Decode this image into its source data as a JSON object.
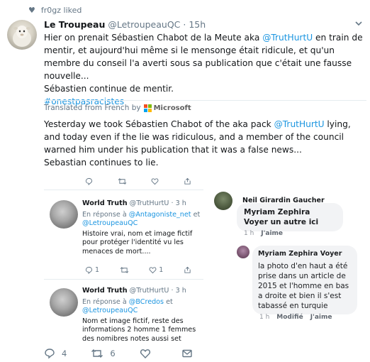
{
  "social_context": {
    "text": "fr0gz liked"
  },
  "tweet": {
    "author_name": "Le Troupeau",
    "author_handle": "@LetroupeauQC",
    "separator": "·",
    "time": "15h",
    "text_part1": "Hier on prenait Sébastien Chabot de la Meute aka ",
    "mention": "@TrutHurtU",
    "text_part2": " en train de mentir, et aujourd'hui même si le mensonge était ridicule, et qu'un membre du conseil l'a averti sous sa publication que c'était une fausse nouvelle...",
    "text_line3": "Sébastien continue de mentir.",
    "hashtag": "#onestpasracistes",
    "translated_label": "Translated from French by",
    "translator_brand": "Microsoft",
    "translation_part1": "Yesterday we took Sébastien Chabot of the aka pack ",
    "translation_mention": "@TrutHurtU",
    "translation_part2": " lying, and today even if the lie was ridiculous, and a member of the council warned him under his publication that it was a false news...",
    "translation_line2": "Sebastian continues to lie."
  },
  "embedded": {
    "tweets": [
      {
        "name": "World Truth",
        "handle": "@TrutHurtU",
        "time": "· 3 h",
        "reply_prefix": "En réponse à ",
        "reply_to_1": "@Antagoniste_net",
        "reply_joiner": " et",
        "reply_to_2": "@LetroupeauQC",
        "text": "Histoire vrai, nom et image fictif pour protéger l'identité vu les menaces de mort....",
        "reply_count": "1",
        "like_count": "1"
      },
      {
        "name": "World Truth",
        "handle": "@TrutHurtU",
        "time": "· 3 h",
        "reply_prefix": "En réponse à ",
        "reply_to_1": "@BCredos",
        "reply_joiner": " et",
        "reply_to_2": "@LetroupeauQC",
        "text": "Nom et image fictif, reste des informations 2 homme 1 femmes des nomibres notes aussi set"
      }
    ],
    "comments": [
      {
        "name": "Neil Girardin Gaucher",
        "text": "Myriam Zephira Voyer un autre ici",
        "time": "1 h",
        "like": "J'aime"
      },
      {
        "name": "Myriam Zephira Voyer",
        "text": "la photo d'en haut a été prise dans un article de 2015 et l'homme en bas a droite et bien il s'est tabassé en turquie",
        "time": "1 h",
        "edited": "Modifié",
        "like": "J'aime"
      }
    ]
  },
  "actions": {
    "reply_count": "4",
    "retweet_count": "6",
    "like_count": "",
    "icons": [
      "reply-icon",
      "retweet-icon",
      "like-icon",
      "dm-icon"
    ]
  },
  "colors": {
    "link": "#1b95e0",
    "muted": "#657786",
    "text": "#14171a"
  }
}
